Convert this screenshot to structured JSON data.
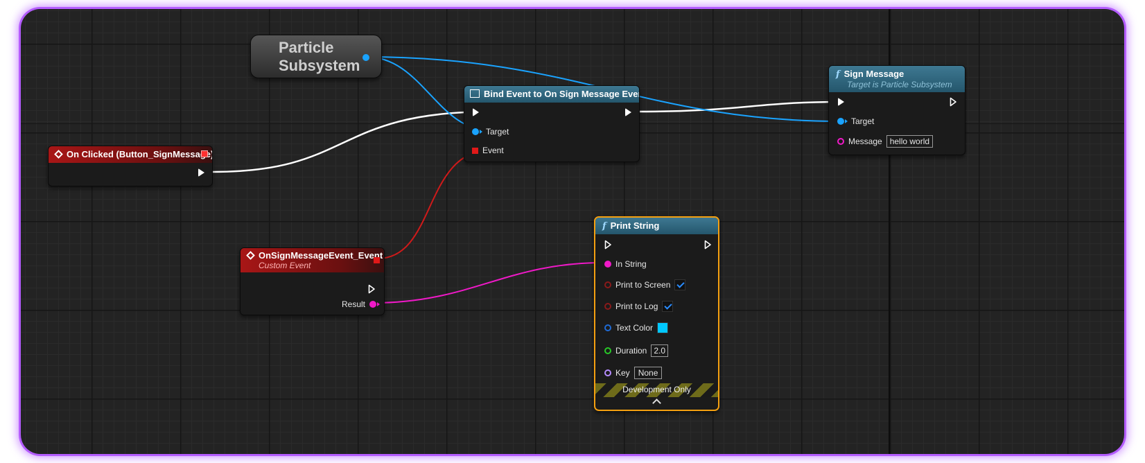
{
  "nodes": {
    "particle_subsystem": {
      "title": "Particle Subsystem"
    },
    "on_clicked": {
      "title": "On Clicked (Button_SignMessage)"
    },
    "bind_event": {
      "title": "Bind Event to On Sign Message Event",
      "pins": {
        "target": "Target",
        "event": "Event"
      }
    },
    "sign_message": {
      "title": "Sign Message",
      "subtitle": "Target is Particle Subsystem",
      "pins": {
        "target": "Target",
        "message": "Message"
      },
      "message_value": "hello world"
    },
    "custom_event": {
      "title": "OnSignMessageEvent_Event",
      "subtitle": "Custom Event",
      "pins": {
        "result": "Result"
      }
    },
    "print_string": {
      "title": "Print String",
      "pins": {
        "in_string": "In String",
        "print_to_screen": "Print to Screen",
        "print_to_log": "Print to Log",
        "text_color": "Text Color",
        "duration": "Duration",
        "key": "Key"
      },
      "values": {
        "print_to_screen": true,
        "print_to_log": true,
        "text_color": "#00c8ff",
        "duration": "2.0",
        "key": "None"
      },
      "footer": "Development Only"
    }
  },
  "colors": {
    "exec_wire": "#ffffff",
    "object_wire": "#1aa3ff",
    "delegate_wire": "#d01a1a",
    "string_wire": "#f019c8",
    "frame_glow": "#b45cff",
    "selected_border": "#f5a010"
  },
  "icons": {
    "function": "function-f-icon",
    "event": "event-diamond-icon",
    "bind": "bind-event-icon"
  }
}
